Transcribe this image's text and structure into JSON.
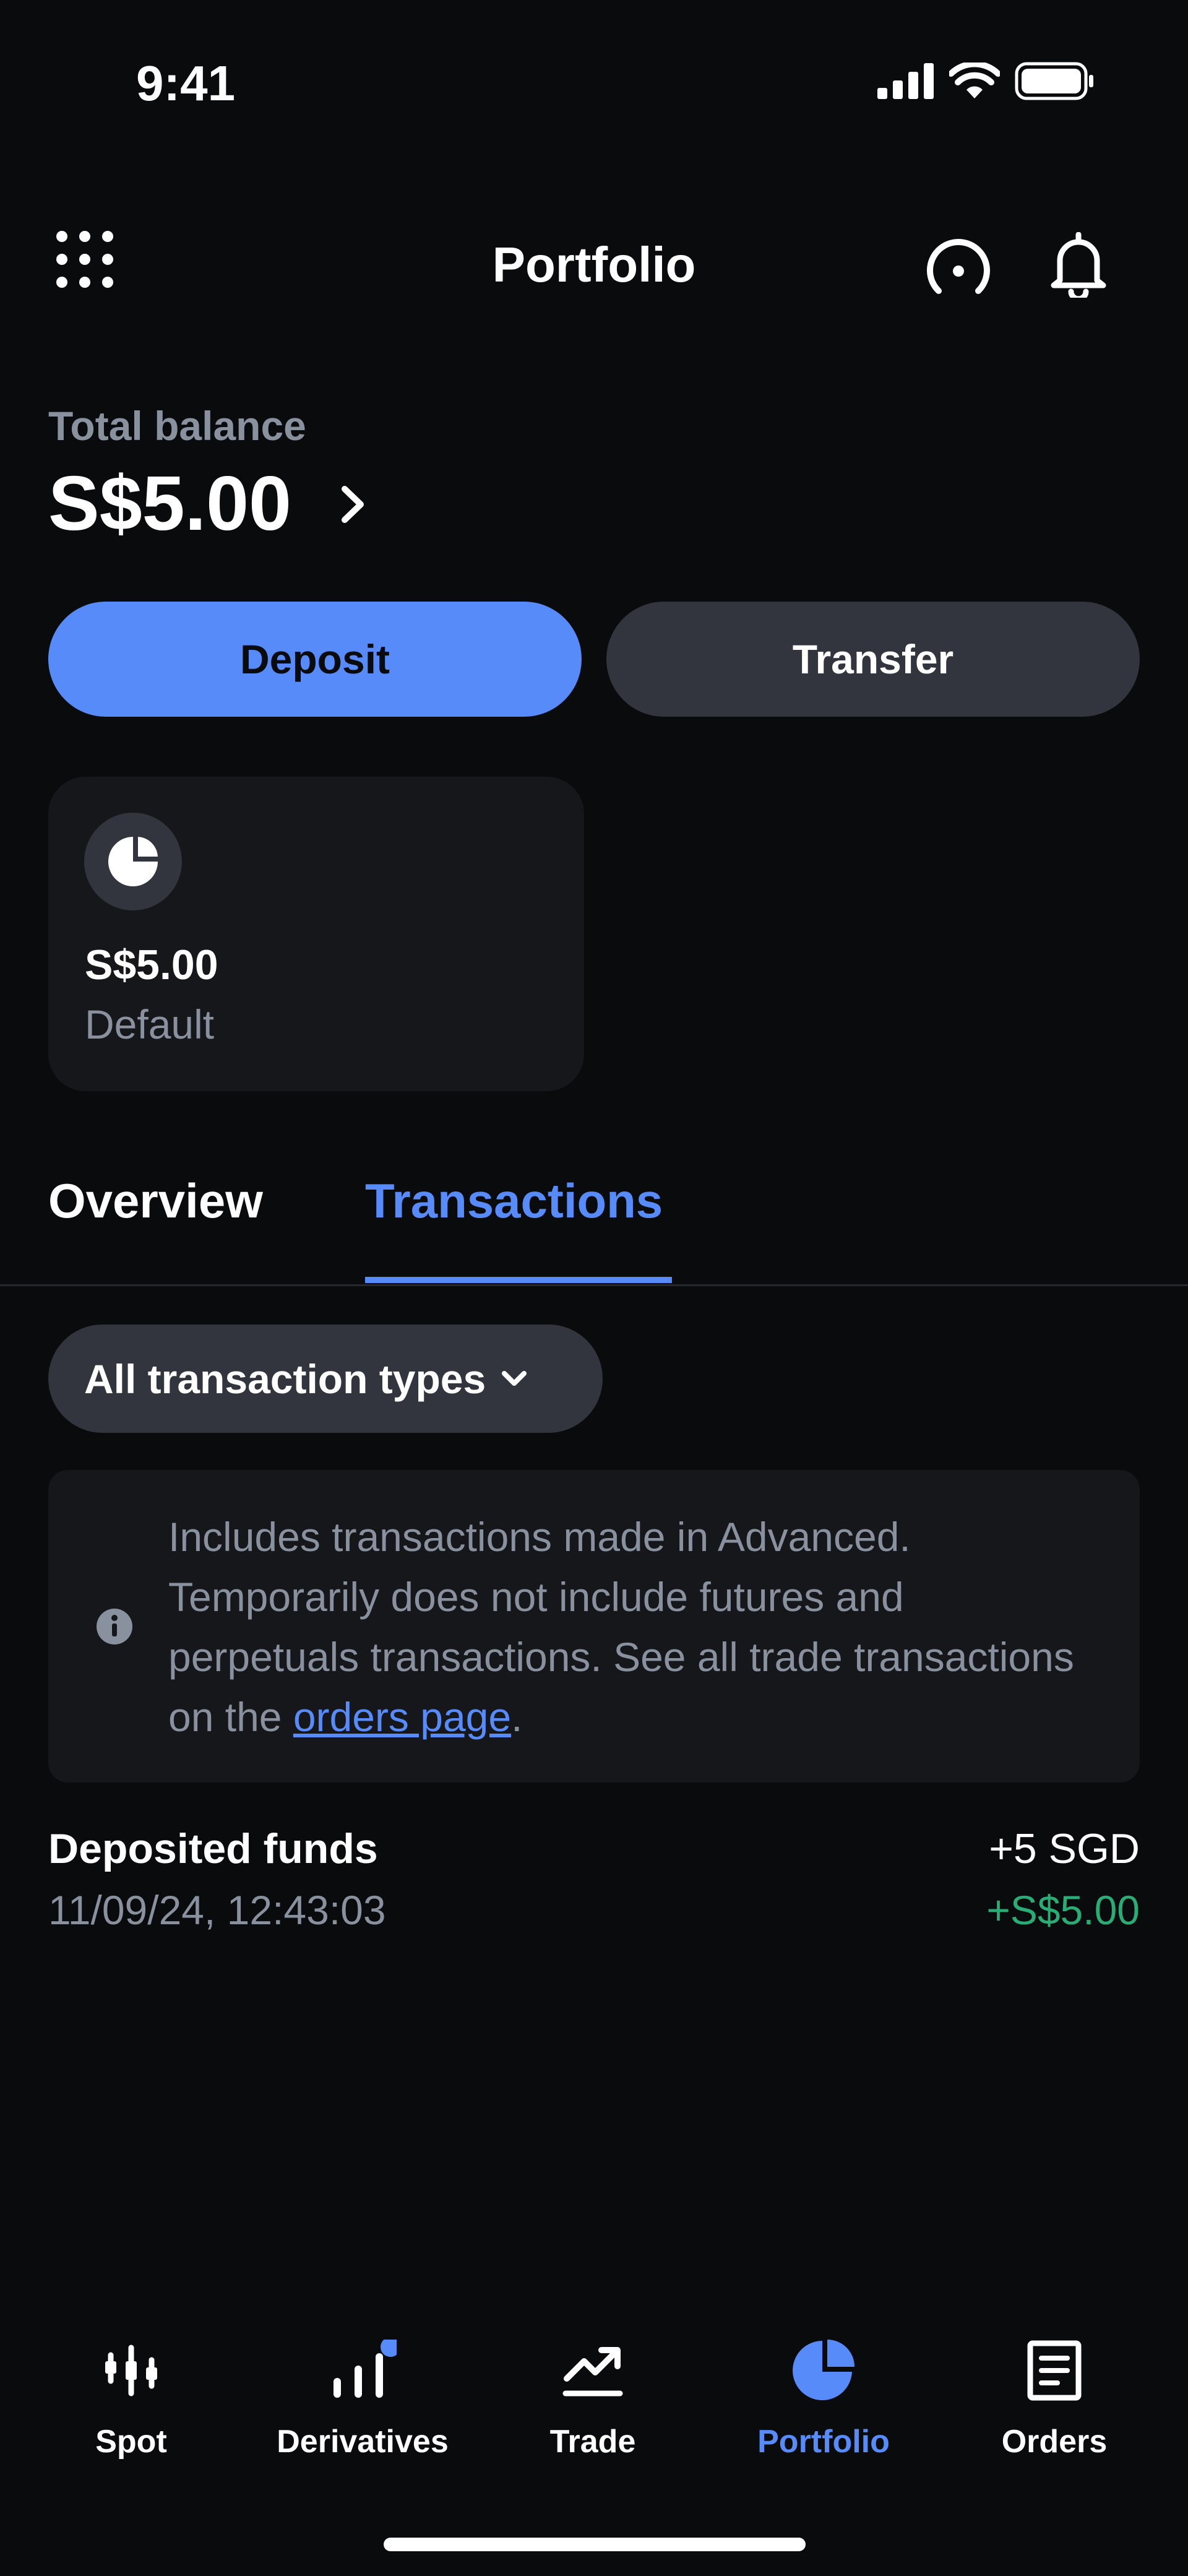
{
  "status_bar": {
    "time": "9:41"
  },
  "header": {
    "title": "Portfolio"
  },
  "balance": {
    "label": "Total balance",
    "value": "S$5.00"
  },
  "actions": {
    "deposit": "Deposit",
    "transfer": "Transfer"
  },
  "account_card": {
    "amount": "S$5.00",
    "name": "Default"
  },
  "tabs": [
    {
      "label": "Overview",
      "active": false
    },
    {
      "label": "Transactions",
      "active": true
    }
  ],
  "filter": {
    "label": "All transaction types"
  },
  "info": {
    "text": "Includes transactions made in Advanced. Temporarily does not include futures and perpetuals transactions. See all trade transactions on the ",
    "link": "orders page",
    "suffix": "."
  },
  "transactions": [
    {
      "title": "Deposited funds",
      "date": "11/09/24, 12:43:03",
      "amount": "+5 SGD",
      "fiat": "+S$5.00"
    }
  ],
  "bottom_nav": [
    {
      "label": "Spot",
      "icon": "candlestick-icon",
      "active": false
    },
    {
      "label": "Derivatives",
      "icon": "bar-chart-icon",
      "active": false,
      "badge": true
    },
    {
      "label": "Trade",
      "icon": "trend-up-icon",
      "active": false
    },
    {
      "label": "Portfolio",
      "icon": "pie-chart-icon",
      "active": true
    },
    {
      "label": "Orders",
      "icon": "document-icon",
      "active": false
    }
  ],
  "colors": {
    "background": "#0a0b0d",
    "accent": "#578bfa",
    "surface": "#16171b",
    "button_secondary": "#32353d",
    "muted_text": "#8a919e",
    "positive": "#27ad75"
  }
}
